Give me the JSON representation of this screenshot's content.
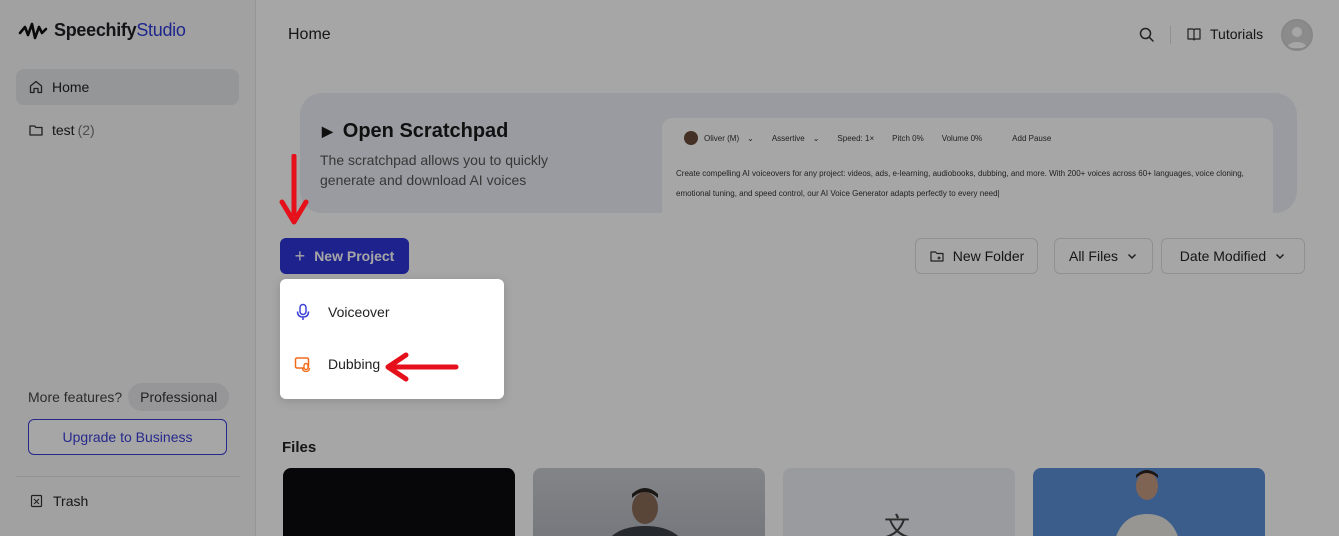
{
  "brand": {
    "name": "Speechify",
    "suffix": "Studio"
  },
  "sidebar": {
    "items": [
      {
        "label": "Home",
        "icon": "home-icon",
        "active": true
      },
      {
        "label": "test",
        "count": "(2)",
        "icon": "folder-icon"
      }
    ],
    "more_features_label": "More features?",
    "plan_badge": "Professional",
    "upgrade_label": "Upgrade to Business",
    "trash_label": "Trash"
  },
  "header": {
    "title": "Home",
    "tutorials_label": "Tutorials"
  },
  "scratchpad": {
    "title": "Open Scratchpad",
    "description": "The scratchpad allows you to quickly generate and download AI voices",
    "editor": {
      "voice": "Oliver (M)",
      "emotion": "Assertive",
      "speed": "Speed: 1×",
      "pitch": "Pitch 0%",
      "volume": "Volume 0%",
      "add_pause": "Add Pause",
      "text": "Create compelling AI voiceovers for any project: videos, ads, e-learning, audiobooks, dubbing, and more. With 200+ voices across 60+ languages, voice cloning, emotional tuning, and speed control, our AI Voice Generator adapts perfectly to every need|"
    }
  },
  "toolbar": {
    "new_project_label": "New Project",
    "new_folder_label": "New Folder",
    "filter_label": "All Files",
    "sort_label": "Date Modified"
  },
  "dropdown": {
    "items": [
      {
        "label": "Voiceover",
        "icon": "microphone-icon",
        "color": "#3b40d8"
      },
      {
        "label": "Dubbing",
        "icon": "dubbing-icon",
        "color": "#f26a1b"
      }
    ]
  },
  "files": {
    "title": "Files"
  },
  "colors": {
    "accent": "#2d35d8",
    "annotation_arrow": "#e5101a",
    "dubbing": "#f26a1b"
  }
}
